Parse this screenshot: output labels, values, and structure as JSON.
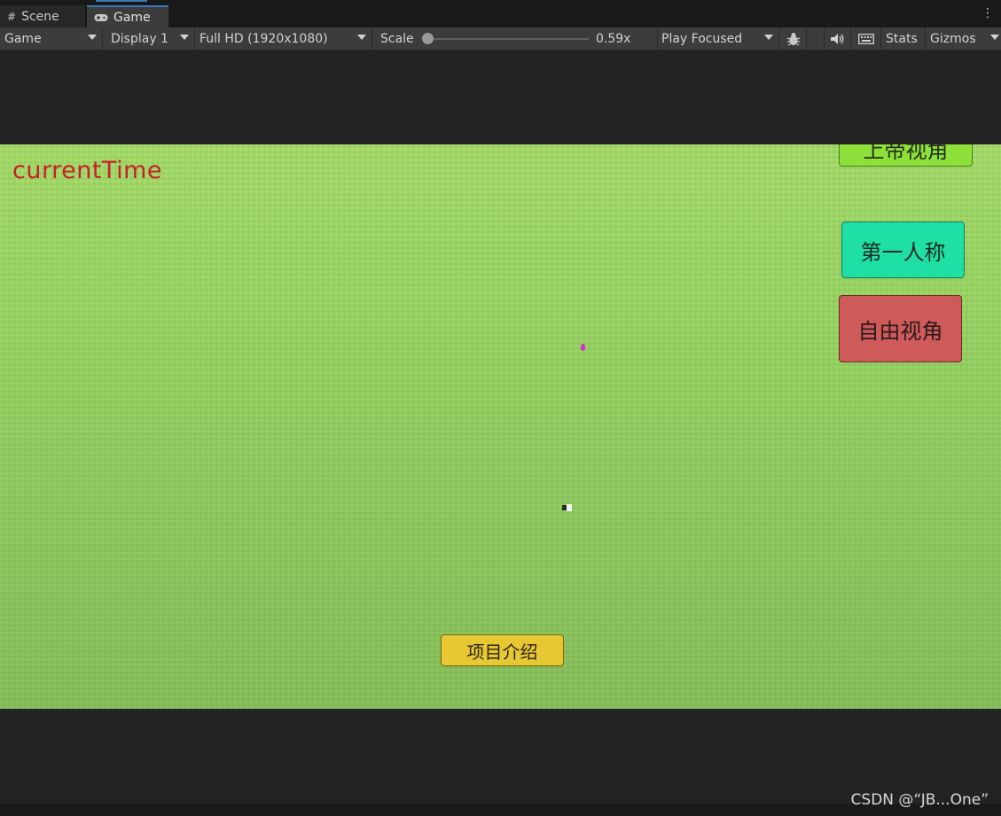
{
  "tabs": [
    {
      "label": "Scene",
      "icon": "grid-icon"
    },
    {
      "label": "Game",
      "icon": "gamepad-icon"
    }
  ],
  "toolbar": {
    "view_mode": "Game",
    "display": "Display 1",
    "resolution": "Full HD (1920x1080)",
    "scale_label": "Scale",
    "scale_value": "0.59x",
    "play_mode": "Play Focused",
    "stats_label": "Stats",
    "gizmos_label": "Gizmos"
  },
  "game": {
    "current_time": "currentTime",
    "god_view_label": "上帝视角",
    "first_person_label": "第一人称",
    "free_view_label": "自由视角",
    "intro_label": "项目介绍"
  },
  "watermark": "CSDN @“JB...One”",
  "colors": {
    "ground": "#98d462",
    "current_time": "#c8202a",
    "god_view": "#8ee03a",
    "first_person": "#1ee0a4",
    "free_view": "#cf5a5a",
    "intro": "#e8c832"
  }
}
